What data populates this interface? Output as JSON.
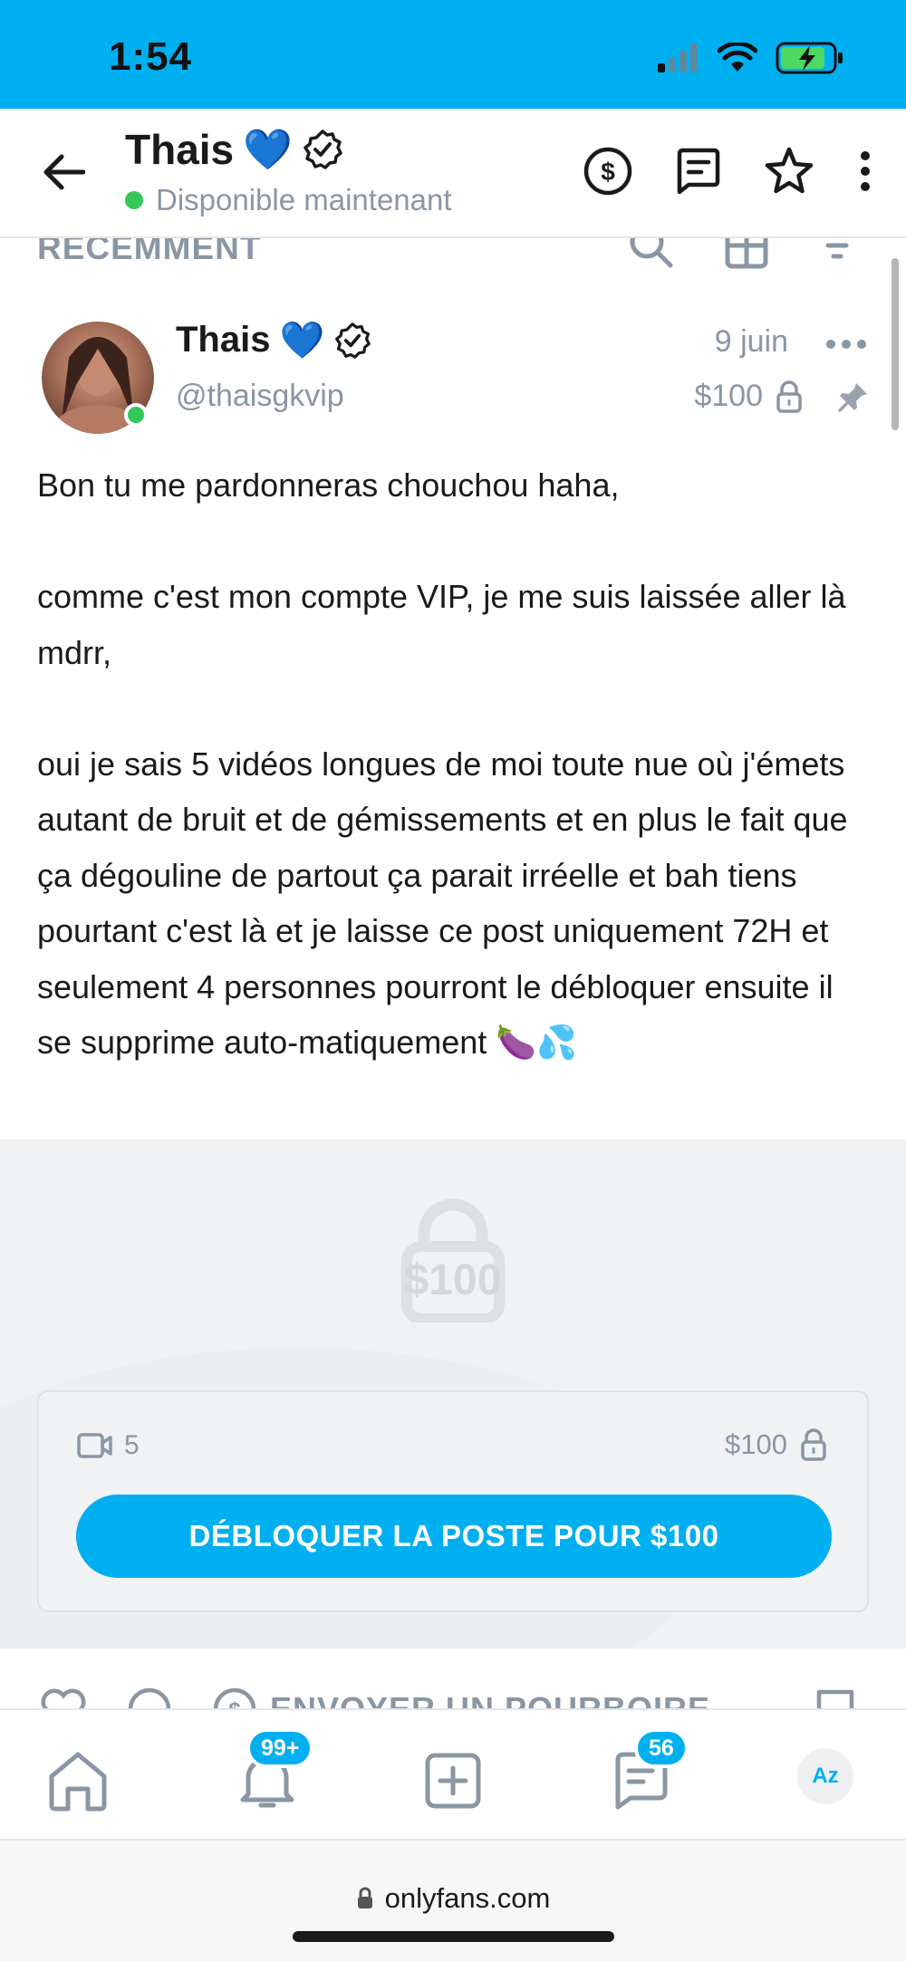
{
  "status_bar": {
    "time": "1:54"
  },
  "header": {
    "name": "Thais",
    "heart_emoji": "💙",
    "status": "Disponible maintenant"
  },
  "toolbar": {
    "label": "RÉCEMMENT"
  },
  "post": {
    "author_name": "Thais",
    "heart_emoji": "💙",
    "handle": "@thaisgkvip",
    "date": "9 juin",
    "price": "$100",
    "paragraphs": [
      "Bon tu me pardonneras chouchou haha,",
      "comme c'est mon compte VIP, je me suis laissée aller là mdrr,",
      "oui je sais 5 vidéos longues de moi toute nue où j'émets autant de bruit et de gémissements et en plus le fait que ça dégouline de partout ça parait irréelle et bah tiens pourtant c'est là et je laisse ce post uniquement 72H et seulement 4 personnes pourront le débloquer ensuite il se supprime auto-matiquement 🍆💦"
    ]
  },
  "locked_media": {
    "price_overlay": "$100",
    "video_count": "5",
    "price": "$100",
    "unlock_button": "DÉBLOQUER LA POSTE POUR $100"
  },
  "actions": {
    "tip_label": "ENVOYER UN POURBOIRE"
  },
  "bottom_nav": {
    "notifications_badge": "99+",
    "messages_badge": "56",
    "profile_initials": "Az"
  },
  "browser": {
    "url": "onlyfans.com"
  },
  "colors": {
    "accent": "#00aff0",
    "muted": "#8a96a3",
    "online": "#34c759"
  }
}
